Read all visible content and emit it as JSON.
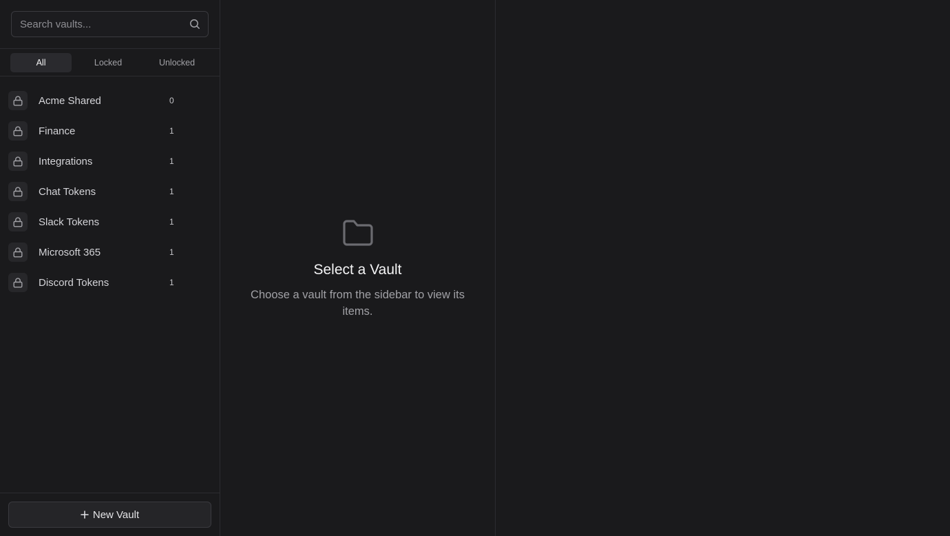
{
  "search": {
    "placeholder": "Search vaults..."
  },
  "tabs": [
    {
      "label": "All",
      "active": true
    },
    {
      "label": "Locked",
      "active": false
    },
    {
      "label": "Unlocked",
      "active": false
    }
  ],
  "vaults": [
    {
      "name": "Acme Shared",
      "count": "0",
      "icon": "lock-icon"
    },
    {
      "name": "Finance",
      "count": "1",
      "icon": "lock-icon"
    },
    {
      "name": "Integrations",
      "count": "1",
      "icon": "lock-icon"
    },
    {
      "name": "Chat Tokens",
      "count": "1",
      "icon": "lock-icon"
    },
    {
      "name": "Slack Tokens",
      "count": "1",
      "icon": "lock-icon"
    },
    {
      "name": "Microsoft 365",
      "count": "1",
      "icon": "lock-icon"
    },
    {
      "name": "Discord Tokens",
      "count": "1",
      "icon": "lock-icon"
    }
  ],
  "footer": {
    "new_vault_label": "New Vault"
  },
  "empty_state": {
    "icon": "folder-icon",
    "title": "Select a Vault",
    "description": "Choose a vault from the sidebar to view its items."
  },
  "colors": {
    "background": "#1a1a1c",
    "border": "#2c2c30",
    "active_tab": "#2a2a2e",
    "text_primary": "#f4f4f5",
    "text_muted": "#a1a1a6"
  }
}
